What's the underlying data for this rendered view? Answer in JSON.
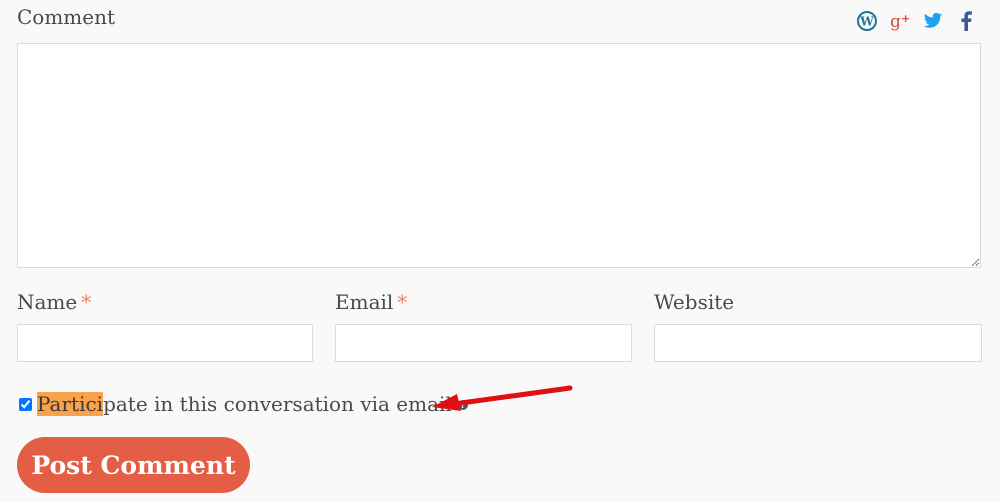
{
  "comment": {
    "label": "Comment",
    "value": ""
  },
  "social": {
    "icons": [
      "wordpress-icon",
      "google-plus-icon",
      "twitter-icon",
      "facebook-icon"
    ],
    "colors": {
      "wordpress": "#21759b",
      "google_plus": "#dd4b39",
      "twitter": "#1da1f2",
      "facebook": "#3b5998"
    }
  },
  "fields": {
    "name": {
      "label": "Name",
      "required_mark": "*",
      "value": ""
    },
    "email": {
      "label": "Email",
      "required_mark": "*",
      "value": ""
    },
    "website": {
      "label": "Website",
      "value": ""
    }
  },
  "subscribe": {
    "checked": true,
    "highlighted_text": "Partici",
    "rest_text": "pate in this conversation via email",
    "help_icon": "question-icon"
  },
  "submit": {
    "label": "Post Comment"
  },
  "colors": {
    "button": "#e45d45",
    "highlight": "#f9a24a",
    "required": "#f08060",
    "annotation_arrow": "#e01010"
  }
}
